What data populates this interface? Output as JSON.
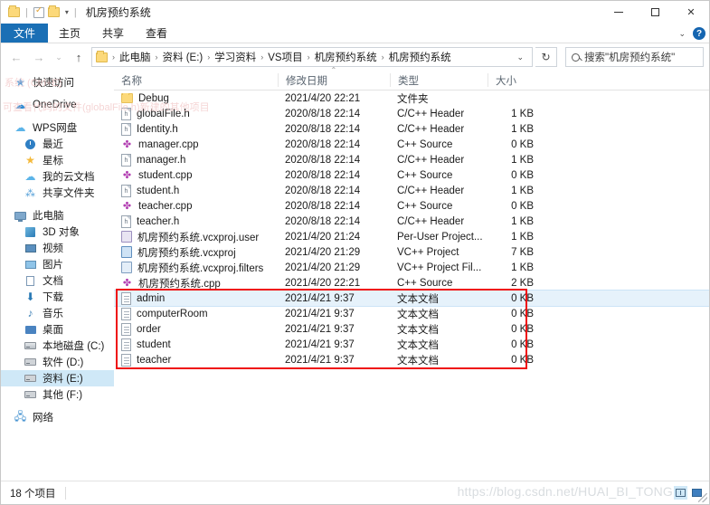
{
  "window": {
    "title": "机房预约系统",
    "quick_access": [
      "folder-icon",
      "properties-icon",
      "new-folder-icon"
    ],
    "controls": {
      "minimize": "minimize-icon",
      "maximize": "maximize-icon",
      "close": "close-icon"
    }
  },
  "ribbon": {
    "tabs": [
      {
        "label": "文件",
        "active": true
      },
      {
        "label": "主页",
        "active": false
      },
      {
        "label": "共享",
        "active": false
      },
      {
        "label": "查看",
        "active": false
      }
    ],
    "collapse": "chevron-down-icon",
    "help": "?"
  },
  "navigation": {
    "back": "←",
    "forward": "→",
    "recent": "⌄",
    "up": "↑",
    "breadcrumbs": [
      "此电脑",
      "资料 (E:)",
      "学习资料",
      "VS项目",
      "机房预约系统",
      "机房预约系统"
    ],
    "separator": "›",
    "dropdown": "⌄",
    "refresh": "↻"
  },
  "search": {
    "placeholder": "搜索\"机房预约系统\"",
    "value": ""
  },
  "sidebar": {
    "items": [
      {
        "label": "快速访问",
        "icon": "pin-star-icon",
        "level": 0,
        "selected": false,
        "gap_before": false
      },
      {
        "label": "OneDrive",
        "icon": "onedrive-cloud-icon",
        "level": 0,
        "selected": false,
        "gap_before": true
      },
      {
        "label": "WPS网盘",
        "icon": "wps-cloud-icon",
        "level": 0,
        "selected": false,
        "gap_before": true
      },
      {
        "label": "最近",
        "icon": "clock-icon",
        "level": 1,
        "selected": false,
        "gap_before": false
      },
      {
        "label": "星标",
        "icon": "star-icon",
        "level": 1,
        "selected": false,
        "gap_before": false
      },
      {
        "label": "我的云文档",
        "icon": "cloud-doc-icon",
        "level": 1,
        "selected": false,
        "gap_before": false
      },
      {
        "label": "共享文件夹",
        "icon": "share-folder-icon",
        "level": 1,
        "selected": false,
        "gap_before": false
      },
      {
        "label": "此电脑",
        "icon": "this-pc-icon",
        "level": 0,
        "selected": false,
        "gap_before": true
      },
      {
        "label": "3D 对象",
        "icon": "3d-objects-icon",
        "level": 1,
        "selected": false,
        "gap_before": false
      },
      {
        "label": "视频",
        "icon": "videos-icon",
        "level": 1,
        "selected": false,
        "gap_before": false
      },
      {
        "label": "图片",
        "icon": "pictures-icon",
        "level": 1,
        "selected": false,
        "gap_before": false
      },
      {
        "label": "文档",
        "icon": "documents-icon",
        "level": 1,
        "selected": false,
        "gap_before": false
      },
      {
        "label": "下载",
        "icon": "downloads-icon",
        "level": 1,
        "selected": false,
        "gap_before": false
      },
      {
        "label": "音乐",
        "icon": "music-icon",
        "level": 1,
        "selected": false,
        "gap_before": false
      },
      {
        "label": "桌面",
        "icon": "desktop-icon",
        "level": 1,
        "selected": false,
        "gap_before": false
      },
      {
        "label": "本地磁盘 (C:)",
        "icon": "system-drive-icon",
        "level": 1,
        "selected": false,
        "gap_before": false
      },
      {
        "label": "软件 (D:)",
        "icon": "drive-icon",
        "level": 1,
        "selected": false,
        "gap_before": false
      },
      {
        "label": "资料 (E:)",
        "icon": "drive-icon",
        "level": 1,
        "selected": true,
        "gap_before": false
      },
      {
        "label": "其他 (F:)",
        "icon": "drive-icon",
        "level": 1,
        "selected": false,
        "gap_before": false
      },
      {
        "label": "网络",
        "icon": "network-icon",
        "level": 0,
        "selected": false,
        "gap_before": true
      }
    ]
  },
  "file_list": {
    "columns": [
      {
        "label": "名称",
        "key": "name",
        "sorted": false
      },
      {
        "label": "修改日期",
        "key": "date",
        "sorted": true,
        "direction": "asc"
      },
      {
        "label": "类型",
        "key": "type",
        "sorted": false
      },
      {
        "label": "大小",
        "key": "size",
        "sorted": false
      }
    ],
    "rows": [
      {
        "name": "Debug",
        "date": "2021/4/20 22:21",
        "type": "文件夹",
        "size": "",
        "icon": "folder-icon",
        "selected": false,
        "highlighted": false
      },
      {
        "name": "globalFile.h",
        "date": "2020/8/18 22:14",
        "type": "C/C++ Header",
        "size": "1 KB",
        "icon": "header-file-icon",
        "selected": false,
        "highlighted": false
      },
      {
        "name": "Identity.h",
        "date": "2020/8/18 22:14",
        "type": "C/C++ Header",
        "size": "1 KB",
        "icon": "header-file-icon",
        "selected": false,
        "highlighted": false
      },
      {
        "name": "manager.cpp",
        "date": "2020/8/18 22:14",
        "type": "C++ Source",
        "size": "0 KB",
        "icon": "cpp-source-icon",
        "selected": false,
        "highlighted": false
      },
      {
        "name": "manager.h",
        "date": "2020/8/18 22:14",
        "type": "C/C++ Header",
        "size": "1 KB",
        "icon": "header-file-icon",
        "selected": false,
        "highlighted": false
      },
      {
        "name": "student.cpp",
        "date": "2020/8/18 22:14",
        "type": "C++ Source",
        "size": "0 KB",
        "icon": "cpp-source-icon",
        "selected": false,
        "highlighted": false
      },
      {
        "name": "student.h",
        "date": "2020/8/18 22:14",
        "type": "C/C++ Header",
        "size": "1 KB",
        "icon": "header-file-icon",
        "selected": false,
        "highlighted": false
      },
      {
        "name": "teacher.cpp",
        "date": "2020/8/18 22:14",
        "type": "C++ Source",
        "size": "0 KB",
        "icon": "cpp-source-icon",
        "selected": false,
        "highlighted": false
      },
      {
        "name": "teacher.h",
        "date": "2020/8/18 22:14",
        "type": "C/C++ Header",
        "size": "1 KB",
        "icon": "header-file-icon",
        "selected": false,
        "highlighted": false
      },
      {
        "name": "机房预约系统.vcxproj.user",
        "date": "2021/4/20 21:24",
        "type": "Per-User Project...",
        "size": "1 KB",
        "icon": "user-project-icon",
        "selected": false,
        "highlighted": false
      },
      {
        "name": "机房预约系统.vcxproj",
        "date": "2021/4/20 21:29",
        "type": "VC++ Project",
        "size": "7 KB",
        "icon": "vcxproj-icon",
        "selected": false,
        "highlighted": false
      },
      {
        "name": "机房预约系统.vcxproj.filters",
        "date": "2021/4/20 21:29",
        "type": "VC++ Project Fil...",
        "size": "1 KB",
        "icon": "vcxproj-filters-icon",
        "selected": false,
        "highlighted": false
      },
      {
        "name": "机房预约系统.cpp",
        "date": "2021/4/20 22:21",
        "type": "C++ Source",
        "size": "2 KB",
        "icon": "cpp-source-icon",
        "selected": false,
        "highlighted": false
      },
      {
        "name": "admin",
        "date": "2021/4/21 9:37",
        "type": "文本文档",
        "size": "0 KB",
        "icon": "text-file-icon",
        "selected": true,
        "highlighted": true
      },
      {
        "name": "computerRoom",
        "date": "2021/4/21 9:37",
        "type": "文本文档",
        "size": "0 KB",
        "icon": "text-file-icon",
        "selected": false,
        "highlighted": true
      },
      {
        "name": "order",
        "date": "2021/4/21 9:37",
        "type": "文本文档",
        "size": "0 KB",
        "icon": "text-file-icon",
        "selected": false,
        "highlighted": true
      },
      {
        "name": "student",
        "date": "2021/4/21 9:37",
        "type": "文本文档",
        "size": "0 KB",
        "icon": "text-file-icon",
        "selected": false,
        "highlighted": true
      },
      {
        "name": "teacher",
        "date": "2021/4/21 9:37",
        "type": "文本文档",
        "size": "0 KB",
        "icon": "text-file-icon",
        "selected": false,
        "highlighted": true
      }
    ]
  },
  "annotation": {
    "type": "red-rectangle",
    "color": "#ef1010",
    "covers": [
      "admin",
      "computerRoom",
      "order",
      "student",
      "teacher"
    ]
  },
  "status_bar": {
    "item_count": "18 个项目",
    "view_details": "details-view-icon",
    "view_icons": "large-icons-view-icon"
  },
  "watermark": {
    "text": "https://blog.csdn.net/HUAI_BI_TONG"
  }
}
